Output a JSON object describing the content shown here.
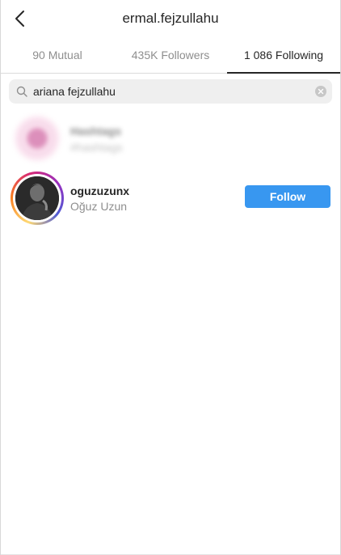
{
  "header": {
    "title": "ermal.fejzullahu",
    "back_icon": "chevron-left-icon"
  },
  "tabs": [
    {
      "label": "90 Mutual",
      "active": false
    },
    {
      "label": "435K Followers",
      "active": false
    },
    {
      "label": "1 086 Following",
      "active": true
    }
  ],
  "search": {
    "value": "ariana fejzullahu",
    "search_icon": "search-icon",
    "clear_icon": "clear-icon"
  },
  "results": [
    {
      "blurred": true,
      "username": "Hashtags",
      "subtitle": "#hashtags"
    },
    {
      "blurred": false,
      "username": "oguzuzunx",
      "full_name": "Oğuz Uzun",
      "has_story": true,
      "action_label": "Follow"
    }
  ],
  "colors": {
    "accent": "#3897f0",
    "text_primary": "#262626",
    "text_secondary": "#8e8e8e",
    "search_bg": "#efefef"
  }
}
